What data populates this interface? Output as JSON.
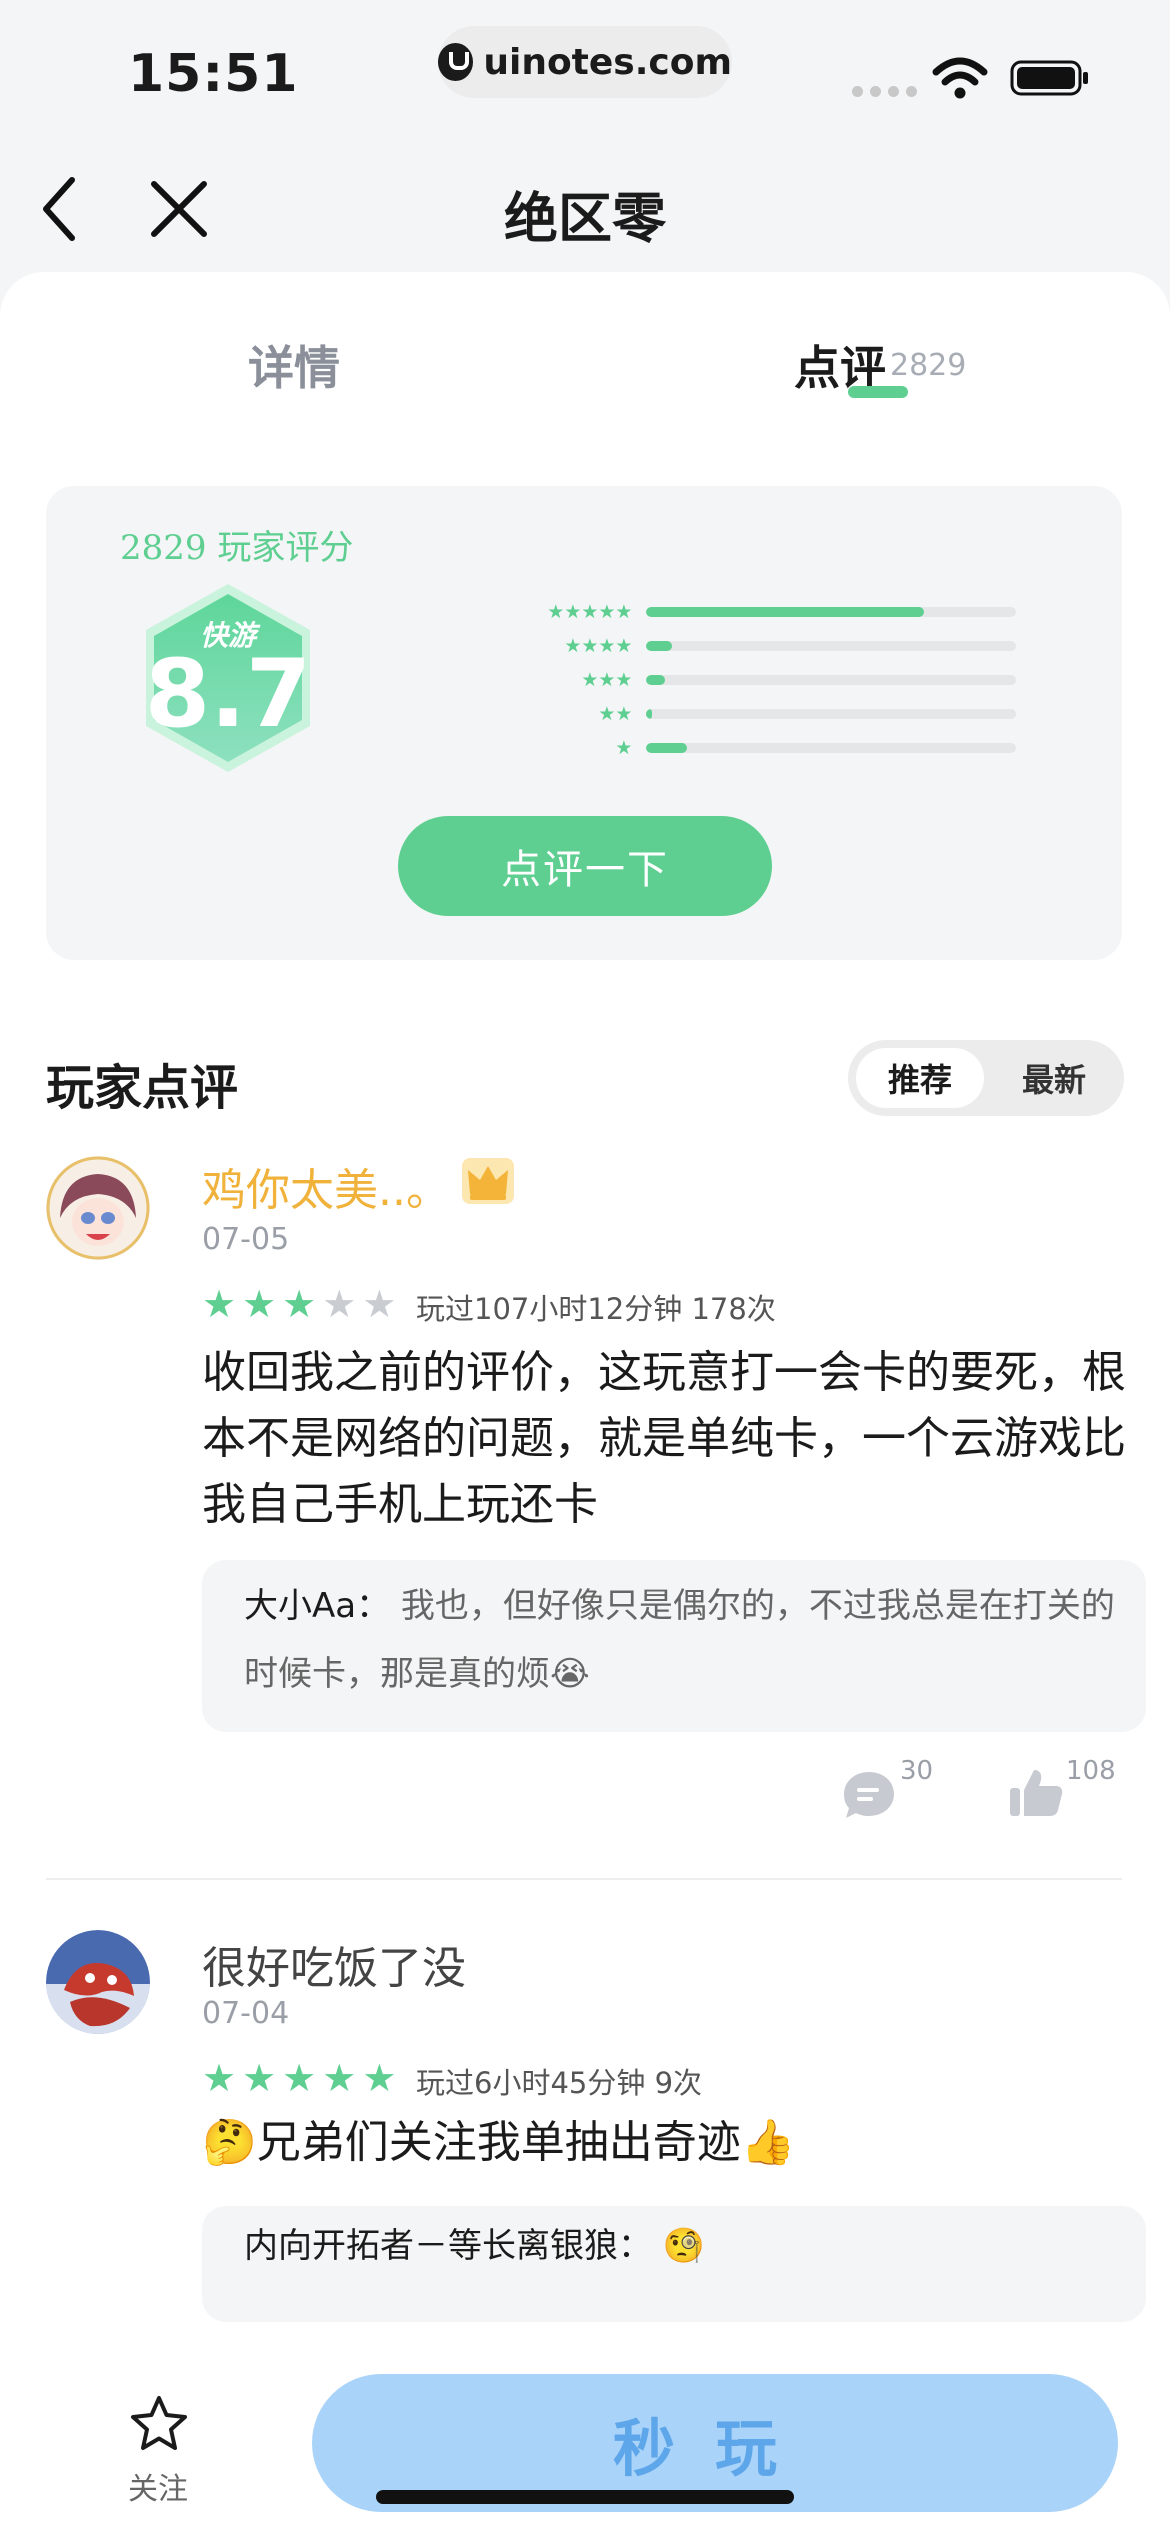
{
  "status_bar": {
    "time": "15:51",
    "url": "uinotes.com"
  },
  "nav": {
    "title": "绝区零"
  },
  "tabs": [
    {
      "label": "详情",
      "active": false
    },
    {
      "label": "点评",
      "active": true,
      "count": "2829"
    }
  ],
  "rating": {
    "caption": "2829 玩家评分",
    "brand": "快游",
    "score": "8.7",
    "distribution": [
      {
        "stars": 5,
        "fraction": 0.75
      },
      {
        "stars": 4,
        "fraction": 0.07
      },
      {
        "stars": 3,
        "fraction": 0.05
      },
      {
        "stars": 2,
        "fraction": 0.01
      },
      {
        "stars": 1,
        "fraction": 0.11
      }
    ],
    "button_label": "点评一下"
  },
  "reviews_section": {
    "title": "玩家点评",
    "sort_options": [
      "推荐",
      "最新"
    ],
    "active_sort": "推荐"
  },
  "reviews": [
    {
      "name": "鸡你太美..。",
      "name_color": "#f0b23a",
      "badge": "crown-icon",
      "date": "07-05",
      "stars": 3,
      "meta": "玩过107小时12分钟 178次",
      "body": "收回我之前的评价，这玩意打一会卡的要死，根本不是网络的问题，就是单纯卡，一个云游戏比我自己手机上玩还卡",
      "reply_user": "大小Aa：",
      "reply_text": "我也，但好像只是偶尔的，不过我总是在打关的时候卡，那是真的烦😭",
      "comments": "30",
      "likes": "108"
    },
    {
      "name": "很好吃饭了没",
      "name_color": "#444444",
      "date": "07-04",
      "stars": 5,
      "meta": "玩过6小时45分钟 9次",
      "body": "🤔兄弟们关注我单抽出奇迹👍",
      "reply_user": "内向开拓者－等长离银狼：",
      "reply_text": "🧐"
    }
  ],
  "bottom_bar": {
    "follow_label": "关注",
    "play_label": "秒玩"
  },
  "colors": {
    "accent": "#5ecf91",
    "play_button": "#a9d3f9",
    "play_text": "#5ea6ea"
  }
}
